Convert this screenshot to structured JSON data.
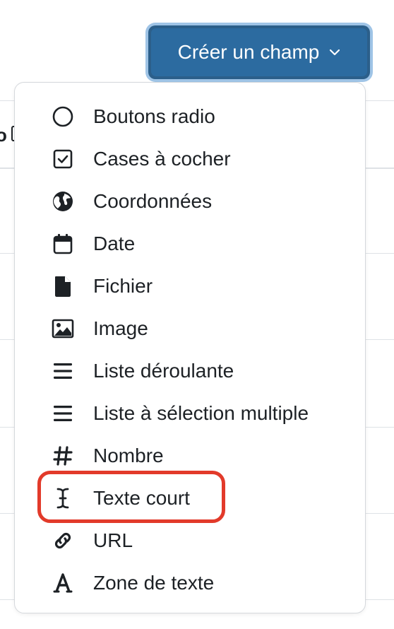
{
  "button": {
    "label": "Créer un champ",
    "color": "#2c6ba0",
    "focus_ring": "#9fc4e6"
  },
  "menu": {
    "items": [
      {
        "label": "Boutons radio",
        "icon": "circle-icon"
      },
      {
        "label": "Cases à cocher",
        "icon": "checkbox-icon"
      },
      {
        "label": "Coordonnées",
        "icon": "globe-icon"
      },
      {
        "label": "Date",
        "icon": "calendar-icon"
      },
      {
        "label": "Fichier",
        "icon": "file-icon"
      },
      {
        "label": "Image",
        "icon": "image-icon"
      },
      {
        "label": "Liste déroulante",
        "icon": "list-icon"
      },
      {
        "label": "Liste à sélection multiple",
        "icon": "list-icon"
      },
      {
        "label": "Nombre",
        "icon": "hash-icon"
      },
      {
        "label": "Texte court",
        "icon": "text-cursor-icon",
        "highlighted": true
      },
      {
        "label": "URL",
        "icon": "link-icon"
      },
      {
        "label": "Zone de texte",
        "icon": "font-icon"
      }
    ],
    "highlight_color": "#e23a2a"
  },
  "background": {
    "header_fragment": "o"
  }
}
